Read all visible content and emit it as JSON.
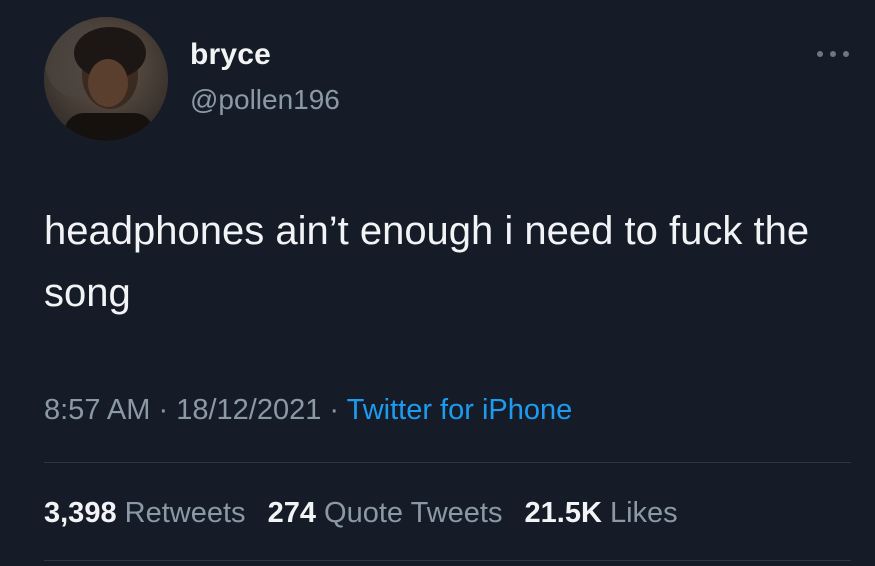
{
  "user": {
    "display_name": "bryce",
    "handle": "@pollen196"
  },
  "tweet": {
    "text": "headphones ain’t enough i need to fuck the song",
    "time": "8:57 AM",
    "separator": " · ",
    "date": "18/12/2021",
    "source": "Twitter for iPhone"
  },
  "stats": {
    "retweets_count": "3,398",
    "retweets_label": "Retweets",
    "quotes_count": "274",
    "quotes_label": "Quote Tweets",
    "likes_count": "21.5K",
    "likes_label": "Likes"
  },
  "icons": {
    "more": "more-horizontal-icon",
    "avatar": "profile-photo"
  },
  "colors": {
    "background": "#151c28",
    "text": "#f2f3f5",
    "secondary": "#8b98a5",
    "accent": "#1d9bf0"
  }
}
